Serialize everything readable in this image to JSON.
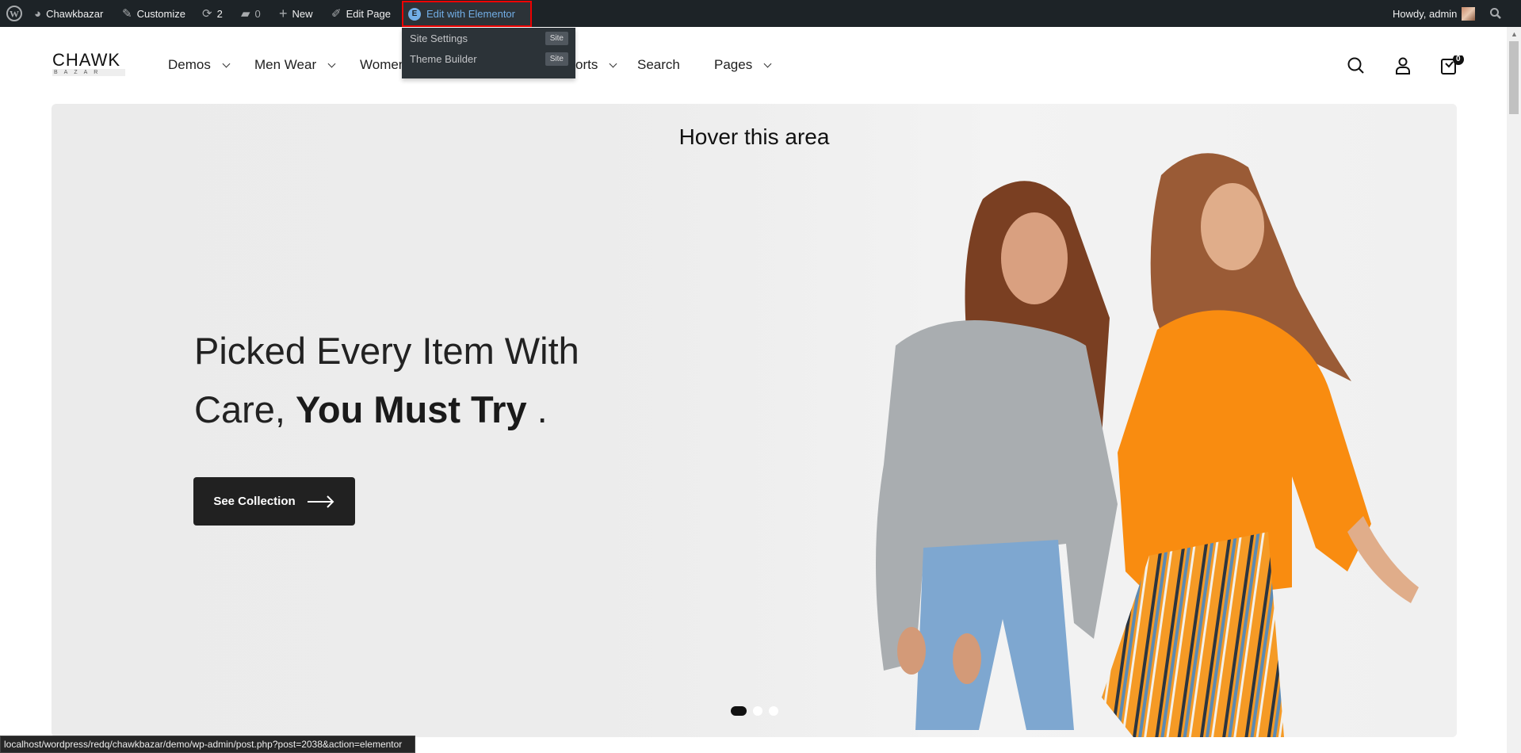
{
  "adminbar": {
    "site_name": "Chawkbazar",
    "customize": "Customize",
    "updates_count": "2",
    "comments_count": "0",
    "new": "New",
    "edit_page": "Edit Page",
    "edit_elementor": "Edit with Elementor",
    "elementor_icon_letter": "E",
    "howdy": "Howdy, admin",
    "dropdown": [
      {
        "label": "Site Settings",
        "badge": "Site"
      },
      {
        "label": "Theme Builder",
        "badge": "Site"
      }
    ]
  },
  "header": {
    "logo_top": "CHAWK",
    "logo_bottom": "BAZAR",
    "nav": [
      {
        "label": "Demos"
      },
      {
        "label": "Men Wear"
      },
      {
        "label": "Women"
      },
      {
        "label": "orts"
      },
      {
        "label": "Search"
      },
      {
        "label": "Pages"
      }
    ],
    "cart_count": "0"
  },
  "hero": {
    "hover_label": "Hover this area",
    "heading_line1": "Picked Every Item With",
    "heading_line2_regular": "Care, ",
    "heading_line2_bold": "You Must Try",
    "heading_line2_end": " .",
    "cta": "See Collection",
    "slides_total": 3,
    "active_slide": 1
  },
  "statusbar": {
    "url": "localhost/wordpress/redq/chawkbazar/demo/wp-admin/post.php?post=2038&action=elementor"
  },
  "colors": {
    "adminbar": "#1d2327",
    "highlight": "#ff0000",
    "elementor_link": "#72aee6",
    "button": "#212121",
    "sweater_gray": "#a9adb0",
    "sweater_orange": "#f98c10"
  }
}
